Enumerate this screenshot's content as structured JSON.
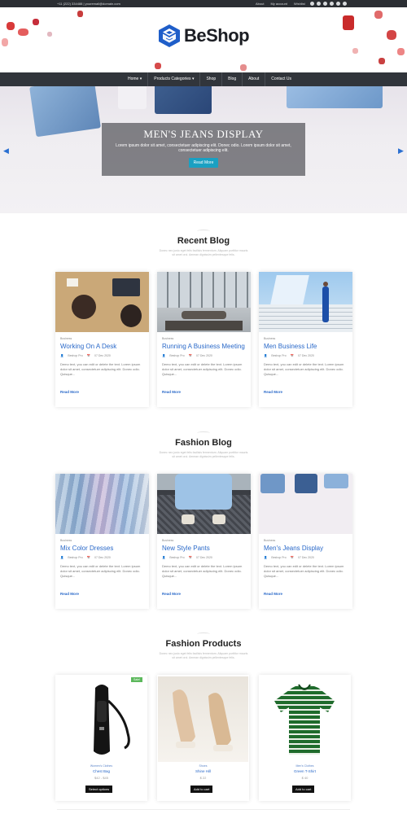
{
  "topbar": {
    "contact": "+11 (222) 334488 | youremail@domain.com",
    "links": [
      "About",
      "My account",
      "Wishlist"
    ],
    "social_icons": [
      "facebook-icon",
      "twitter-icon",
      "vimeo-icon",
      "email-icon",
      "instagram-icon",
      "dribbble-icon"
    ]
  },
  "header": {
    "brand": "BeShop",
    "logo_color": "#1f5ec9"
  },
  "nav": {
    "items": [
      "Home",
      "Products Categories",
      "Shop",
      "Blog",
      "About",
      "Contact Us"
    ]
  },
  "hero": {
    "title": "MEN'S JEANS DISPLAY",
    "text": "Lorem ipsum dolor sit amet, consectetuer adipiscing elit. Donec odio. Lorem ipsum dolor sit amet, consectetuer adipiscing elit.",
    "button": "Read More",
    "button_color": "#1aa0c2"
  },
  "sections": {
    "recent_blog": {
      "title": "Recent Blog",
      "subtitle": [
        "Donec nec justo eget felis facilisis fermentum. Aliquam porttitor mauris",
        "sit amet orci. Aenean dignissim pellentesque felis."
      ]
    },
    "fashion_blog": {
      "title": "Fashion Blog",
      "subtitle": [
        "Donec nec justo eget felis facilisis fermentum. Aliquam porttitor mauris",
        "sit amet orci. Aenean dignissim pellentesque felis."
      ]
    },
    "fashion_products": {
      "title": "Fashion Products",
      "subtitle": [
        "Donec nec justo eget felis facilisis fermentum. Aliquam porttitor mauris",
        "sit amet orci. Aenean dignissim pellentesque felis."
      ]
    }
  },
  "recent_posts": [
    {
      "category": "Business",
      "title": "Working On A Desk",
      "author": "Beshop Pro",
      "date": "07 Dec 2020",
      "excerpt": "Demo text, you can edit or delete the text. Lorem ipsum dolor sit amet, consectetuer adipiscing elit. Donec odio. Quisque...",
      "more": "Read More"
    },
    {
      "category": "Business",
      "title": "Running A Business Meeting",
      "author": "Beshop Pro",
      "date": "07 Dec 2020",
      "excerpt": "Demo text, you can edit or delete the text. Lorem ipsum dolor sit amet, consectetuer adipiscing elit. Donec odio. Quisque...",
      "more": "Read More"
    },
    {
      "category": "Business",
      "title": "Men Business Life",
      "author": "Beshop Pro",
      "date": "07 Dec 2020",
      "excerpt": "Demo text, you can edit or delete the text. Lorem ipsum dolor sit amet, consectetuer adipiscing elit. Donec odio. Quisque...",
      "more": "Read More"
    }
  ],
  "fashion_posts": [
    {
      "category": "Business",
      "title": "Mix Color Dresses",
      "author": "Beshop Pro",
      "date": "07 Dec 2020",
      "excerpt": "Demo text, you can edit or delete the text. Lorem ipsum dolor sit amet, consectetuer adipiscing elit. Donec odio. Quisque...",
      "more": "Read More"
    },
    {
      "category": "Business",
      "title": "New Style Pants",
      "author": "Beshop Pro",
      "date": "07 Dec 2020",
      "excerpt": "Demo text, you can edit or delete the text. Lorem ipsum dolor sit amet, consectetuer adipiscing elit. Donec odio. Quisque...",
      "more": "Read More"
    },
    {
      "category": "Business",
      "title": "Men's Jeans Display",
      "author": "Beshop Pro",
      "date": "07 Dec 2020",
      "excerpt": "Demo text, you can edit or delete the text. Lorem ipsum dolor sit amet, consectetuer adipiscing elit. Donec odio. Quisque...",
      "more": "Read More"
    }
  ],
  "products": [
    {
      "badge": "Sale!",
      "category": "Women's Clothes",
      "name": "Chest Bag",
      "price": "$42 - $45",
      "button": "Select options"
    },
    {
      "category": "Shoes",
      "name": "Shine Hill",
      "price": "$ 22",
      "button": "Add to cart"
    },
    {
      "category": "Men's Clothes",
      "name": "Green T-Shirt",
      "price": "$ 40",
      "button": "Add to cart"
    }
  ]
}
